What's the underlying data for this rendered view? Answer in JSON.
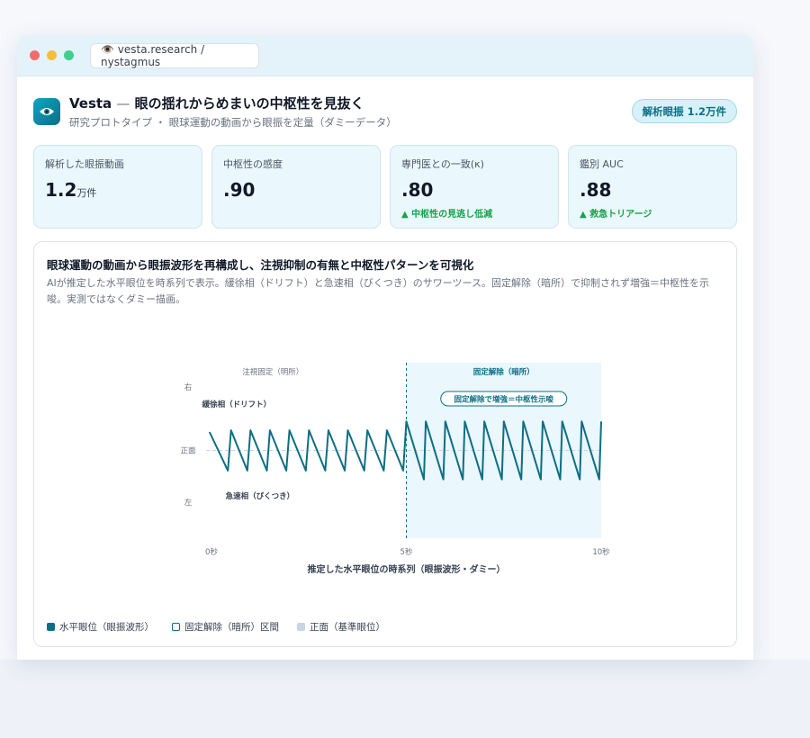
{
  "browser": {
    "url_icon": "eye-icon",
    "url": "👁️ vesta.research / nystagmus"
  },
  "header": {
    "logo_icon": "eye-icon",
    "app_name": "Vesta",
    "separator": "—",
    "tagline": "眼の揺れからめまいの中枢性を見抜く",
    "subtitle": "研究プロトタイプ ・ 眼球運動の動画から眼振を定量（ダミーデータ）",
    "badge": "解析眼振 1.2万件"
  },
  "stats": [
    {
      "label": "解析した眼振動画",
      "value": "1.2",
      "unit": "万件",
      "note": ""
    },
    {
      "label": "中枢性の感度",
      "value": ".90",
      "unit": "",
      "note": ""
    },
    {
      "label": "専門医との一致(κ)",
      "value": ".80",
      "unit": "",
      "note": "▲ 中枢性の見逃し低減"
    },
    {
      "label": "鑑別 AUC",
      "value": ".88",
      "unit": "",
      "note": "▲ 救急トリアージ"
    }
  ],
  "panel": {
    "title": "眼球運動の動画から眼振波形を再構成し、注視抑制の有無と中枢性パターンを可視化",
    "description": "AIが推定した水平眼位を時系列で表示。緩徐相（ドリフト）と急速相（びくつき）のサワーツース。固定解除（暗所）で抑制されず増強＝中枢性を示唆。実測ではなくダミー描画。"
  },
  "chart_data": {
    "type": "line",
    "xlabel": "推定した水平眼位の時系列（眼振波形・ダミー）",
    "x_ticks": [
      "0秒",
      "5秒",
      "10秒"
    ],
    "xlim": [
      0,
      10
    ],
    "y_ticks": [
      "右",
      "正面",
      "左"
    ],
    "ylim": [
      -1,
      1
    ],
    "regions": [
      {
        "label": "注視固定（明所）",
        "x": [
          0,
          5
        ]
      },
      {
        "label": "固定解除（暗所）",
        "x": [
          5,
          10
        ]
      }
    ],
    "annotations": {
      "slow_phase": "緩徐相（ドリフト）",
      "fast_phase": "急速相（びくつき）",
      "callout": "固定解除で増強＝中枢性示唆"
    },
    "series": [
      {
        "name": "水平眼位（眼振波形）",
        "x": [
          -0.05,
          0.42,
          0.5,
          0.92,
          1.0,
          1.42,
          1.5,
          1.92,
          2.0,
          2.42,
          2.5,
          2.92,
          3.0,
          3.42,
          3.5,
          3.92,
          4.0,
          4.42,
          4.5,
          4.92,
          5.0,
          5.45,
          5.5,
          5.95,
          6.0,
          6.45,
          6.5,
          6.95,
          7.0,
          7.45,
          7.5,
          7.95,
          8.0,
          8.45,
          8.5,
          8.95,
          9.0,
          9.45,
          9.5,
          9.95,
          10.0
        ],
        "y": [
          0.21,
          -0.23,
          0.23,
          -0.23,
          0.23,
          -0.23,
          0.23,
          -0.23,
          0.23,
          -0.23,
          0.23,
          -0.23,
          0.23,
          -0.23,
          0.23,
          -0.23,
          0.23,
          -0.23,
          0.23,
          -0.23,
          0.33,
          -0.33,
          0.33,
          -0.33,
          0.33,
          -0.33,
          0.33,
          -0.33,
          0.33,
          -0.33,
          0.33,
          -0.33,
          0.33,
          -0.33,
          0.33,
          -0.33,
          0.33,
          -0.33,
          0.33,
          -0.33,
          0.33
        ]
      }
    ],
    "legend": [
      {
        "label": "水平眼位（眼振波形）"
      },
      {
        "label": "固定解除（暗所）区間"
      },
      {
        "label": "正面（基準眼位）"
      }
    ],
    "colors": {
      "line": "#0e6e83",
      "dark_region": "#eaf7fc",
      "baseline": "#c9d5e0"
    }
  }
}
